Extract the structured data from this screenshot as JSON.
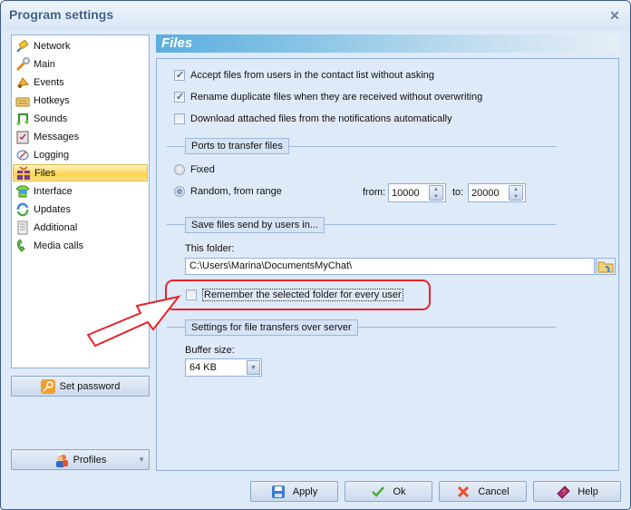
{
  "window": {
    "title": "Program settings"
  },
  "sidebar": {
    "items": [
      {
        "label": "Network",
        "icon": "network-icon"
      },
      {
        "label": "Main",
        "icon": "main-icon"
      },
      {
        "label": "Events",
        "icon": "events-bell-icon"
      },
      {
        "label": "Hotkeys",
        "icon": "keyboard-icon"
      },
      {
        "label": "Sounds",
        "icon": "music-note-icon"
      },
      {
        "label": "Messages",
        "icon": "clipboard-icon"
      },
      {
        "label": "Logging",
        "icon": "logging-icon"
      },
      {
        "label": "Files",
        "icon": "gift-icon",
        "active": true
      },
      {
        "label": "Interface",
        "icon": "interface-icon"
      },
      {
        "label": "Updates",
        "icon": "updates-icon"
      },
      {
        "label": "Additional",
        "icon": "document-icon"
      },
      {
        "label": "Media calls",
        "icon": "phone-icon"
      }
    ],
    "set_password_label": "Set password",
    "profiles_label": "Profiles"
  },
  "content": {
    "header": "Files",
    "options": [
      {
        "label": "Accept files from users in the contact list without asking",
        "checked": true
      },
      {
        "label": "Rename duplicate files when they are received without overwriting",
        "checked": true
      },
      {
        "label": "Download attached files from the notifications automatically",
        "checked": false
      }
    ],
    "ports": {
      "group_label": "Ports to transfer files",
      "fixed_label": "Fixed",
      "random_label": "Random, from range",
      "selected": "random",
      "from_label": "from:",
      "from_value": "10000",
      "to_label": "to:",
      "to_value": "20000"
    },
    "save": {
      "group_label": "Save files send by users in...",
      "folder_label": "This folder:",
      "folder_value": "C:\\Users\\Marina\\DocumentsMyChat\\",
      "remember_label": "Remember the selected folder for every user",
      "remember_checked": false
    },
    "server": {
      "group_label": "Settings for file transfers over server",
      "buffer_label": "Buffer size:",
      "buffer_value": "64 KB"
    }
  },
  "buttons": {
    "apply": "Apply",
    "ok": "Ok",
    "cancel": "Cancel",
    "help": "Help"
  },
  "annotation": {
    "color": "#e8232a"
  }
}
